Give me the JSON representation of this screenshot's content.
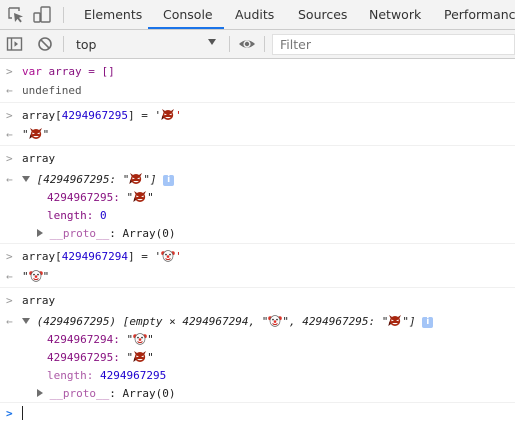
{
  "toolbar_icons": {
    "inspect": "inspect-element-icon",
    "device": "device-toolbar-icon"
  },
  "tabs": [
    {
      "label": "Elements",
      "active": false
    },
    {
      "label": "Console",
      "active": true
    },
    {
      "label": "Audits",
      "active": false
    },
    {
      "label": "Sources",
      "active": false
    },
    {
      "label": "Network",
      "active": false
    },
    {
      "label": "Performance",
      "active": false
    }
  ],
  "console_toolbar": {
    "context": "top",
    "filter_placeholder": "Filter"
  },
  "colors": {
    "accent": "#1a73e8",
    "string": "#c41a16",
    "number": "#1c00cf",
    "property": "#881280",
    "keyword": "#aa0d91"
  },
  "entries": {
    "e1": {
      "code_kw": "var",
      "code_rest": "array = []",
      "result": "undefined"
    },
    "e2": {
      "code_a": "array[",
      "code_num": "4294967295",
      "code_b": "] = '",
      "code_c": "'",
      "result_q1": "\"",
      "result_q2": "\""
    },
    "e3": {
      "code": "array",
      "summary_a": "[4294967295: \"",
      "summary_b": "\"]",
      "prop1_key": "4294967295:",
      "prop1_q1": "\"",
      "prop1_q2": "\"",
      "len_key": "length:",
      "len_val": "0",
      "proto_key": "__proto__",
      "proto_val": ": Array(0)"
    },
    "e4": {
      "code_a": "array[",
      "code_num": "4294967294",
      "code_b": "] = '",
      "code_c": "'",
      "result_q1": "\"",
      "result_q2": "\""
    },
    "e5": {
      "code": "array",
      "summary_a": "(4294967295) [empty × 4294967294, \"",
      "summary_b": "\", 4294967295: \"",
      "summary_c": "\"]",
      "prop1_key": "4294967294:",
      "prop2_key": "4294967295:",
      "q1": "\"",
      "q2": "\"",
      "len_key": "length:",
      "len_val": "4294967295",
      "proto_key": "__proto__",
      "proto_val": ": Array(0)"
    }
  },
  "emoji": {
    "devil": "devil-emoji-icon",
    "clown": "clown-emoji-icon"
  }
}
